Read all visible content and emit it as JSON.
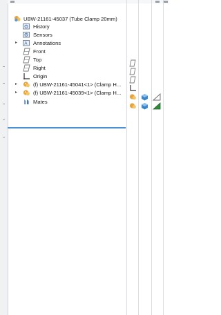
{
  "tree": {
    "root": {
      "label": "UBW-21161-45037 (Tube Clamp 20mm)",
      "icon": "assembly-icon"
    },
    "items": [
      {
        "label": "History",
        "icon": "history-folder-icon",
        "expander": false
      },
      {
        "label": "Sensors",
        "icon": "sensors-folder-icon",
        "expander": false
      },
      {
        "label": "Annotations",
        "icon": "annotations-folder-icon",
        "expander": true
      },
      {
        "label": "Front",
        "icon": "plane-icon",
        "expander": false
      },
      {
        "label": "Top",
        "icon": "plane-icon",
        "expander": false
      },
      {
        "label": "Right",
        "icon": "plane-icon",
        "expander": false
      },
      {
        "label": "Origin",
        "icon": "origin-icon",
        "expander": false
      },
      {
        "label": "(f) UBW-21161-45041<1> (Clamp H...",
        "icon": "part-icon",
        "expander": true
      },
      {
        "label": "(f) UBW-21161-45039<1> (Clamp H...",
        "icon": "part-icon",
        "expander": true
      },
      {
        "label": "Mates",
        "icon": "mates-icon",
        "expander": false
      }
    ]
  },
  "colors": {
    "selection_line": "#4a90d9",
    "part_icon": "#e8a33a",
    "plane_icon": "#7a7a7a"
  }
}
